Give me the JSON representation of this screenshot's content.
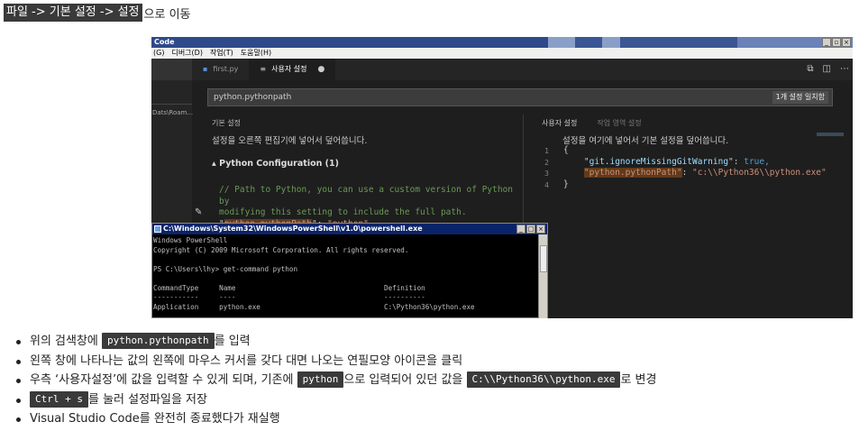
{
  "heading": {
    "menu_path": "파일 -> 기본 설정 -> 설정",
    "suffix": "으로 이동"
  },
  "screenshot": {
    "window_title": "Code",
    "menu": [
      "(G)",
      "디버그(D)",
      "작업(T)",
      "도움말(H)"
    ],
    "sidebar_path": "Dats\\Roam...",
    "tabs": [
      {
        "label": "first.py",
        "active": false
      },
      {
        "label": "사용자 설정",
        "active": true
      }
    ],
    "search_value": "python.pythonpath",
    "search_count": "1개 설정 일치함",
    "left": {
      "header": "기본 설정",
      "description": "설정을 오른쪽 편집기에 넣어서 덮어씁니다.",
      "section": "Python Configuration (1)",
      "comment_lines": [
        "// Path to Python, you can use a custom version of Python by",
        "modifying this setting to include the full path."
      ],
      "key": "python.pythonPath",
      "value": "\"python\","
    },
    "right": {
      "tab_user": "사용자 설정",
      "tab_workspace": "작업 영역 설정",
      "description": "설정을 여기에 넣어서 기본 설정을 덮어씁니다.",
      "line_numbers": [
        "1",
        "2",
        "3",
        "4"
      ],
      "line1": "{",
      "key1": "\"git.ignoreMissingGitWarning\"",
      "val1": "true,",
      "key2": "\"python.pythonPath\"",
      "val2": "\"c:\\\\Python36\\\\python.exe\"",
      "line4": "}"
    },
    "powershell": {
      "title": "C:\\Windows\\System32\\WindowsPowerShell\\v1.0\\powershell.exe",
      "body": "Windows PowerShell\nCopyright (C) 2009 Microsoft Corporation. All rights reserved.\n\nPS C:\\Users\\lhy> get-command python\n\nCommandType     Name                                    Definition\n-----------     ----                                    ----------\nApplication     python.exe                              C:\\Python36\\python.exe"
    }
  },
  "notes": [
    {
      "pre": "위의 검색창에 ",
      "code": "python.pythonpath",
      "post": "를 입력"
    },
    {
      "text": "왼쪽 창에 나타나는 값의 왼쪽에 마우스 커서를 갖다 대면 나오는 연필모양 아이콘을 클릭"
    },
    {
      "pre": "우측 ‘사용자설정’에 값을 입력할 수 있게 되며, 기존에 ",
      "code": "python",
      "mid": "으로 입력되어 있던 값을 ",
      "code2": "C:\\\\Python36\\\\python.exe",
      "post": "로 변경"
    },
    {
      "code": "Ctrl + s",
      "post": "를 눌러 설정파일을 저장"
    },
    {
      "text": "Visual Studio Code를 완전히 종료했다가 재실행"
    }
  ]
}
